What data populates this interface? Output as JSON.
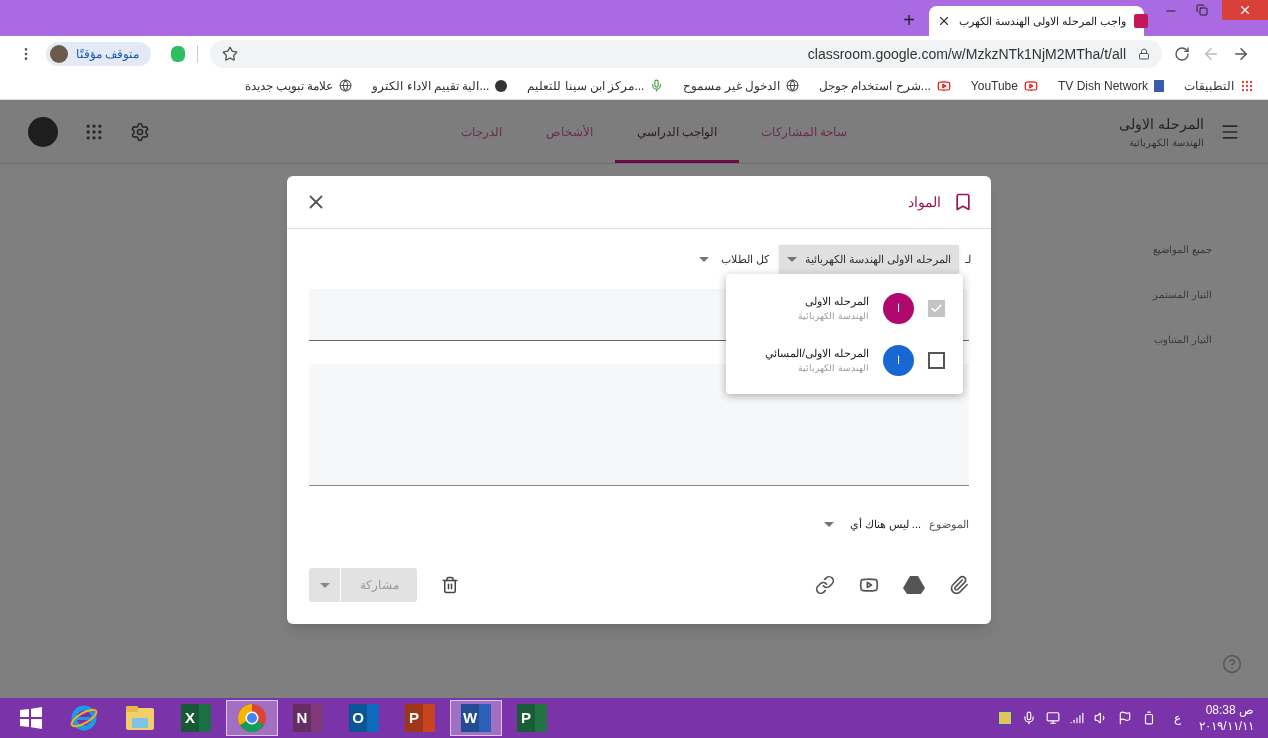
{
  "browser": {
    "tab_title": "واجب المرحله الاولى الهندسة الكهرب",
    "new_tab": "+",
    "url": "classroom.google.com/w/MzkzNTk1NjM2MTha/t/all",
    "profile": "متوقف مؤقتًا"
  },
  "bookmarks": [
    {
      "kind": "apps",
      "label": "التطبيقات"
    },
    {
      "kind": "doc",
      "label": "TV Dish Network"
    },
    {
      "kind": "youtube",
      "label": "YouTube"
    },
    {
      "kind": "youtube",
      "label": "شرح استخدام جوجل..."
    },
    {
      "kind": "globe",
      "label": "الدخول غير مسموح"
    },
    {
      "kind": "mic",
      "label": "مركز ابن سينا للتعليم..."
    },
    {
      "kind": "dark",
      "label": "الية تقييم الاداء الكترو..."
    },
    {
      "kind": "globe",
      "label": "علامة تبويب جديدة"
    }
  ],
  "classroom": {
    "class_name": "المرحله الاولى",
    "class_section": "الهندسة الكهربائية",
    "tabs": [
      {
        "label": "ساحة المشاركات",
        "selected": false
      },
      {
        "label": "الواجب الدراسي",
        "selected": true
      },
      {
        "label": "الأشخاص",
        "selected": false
      },
      {
        "label": "الدرجات",
        "selected": false
      }
    ],
    "topics": [
      "جميع المواضيع",
      "التيار المستمر",
      "التيار المتناوب"
    ]
  },
  "dialog": {
    "title": "المواد",
    "for_label": "لـ",
    "class_chip": "المرحله الاولى الهندسة الكهربائية",
    "students": "كل الطلاب",
    "topic_label": "الموضوع",
    "topic_value": "ليس هناك أي ...",
    "share_button": "مشاركة",
    "share_disabled": true,
    "class_options": [
      {
        "name": "المرحله الاولى",
        "section": "الهندسة الكهربائية",
        "initial": "ا",
        "color": "#b0086f",
        "checked": true
      },
      {
        "name": "المرحله الاولى/المسائي",
        "section": "الهندسة الكهربائية",
        "initial": "ا",
        "color": "#1967d2",
        "checked": false
      }
    ]
  },
  "taskbar": {
    "apps": [
      {
        "kind": "office",
        "letter": "P",
        "color": "#217346",
        "selected": false
      },
      {
        "kind": "office",
        "letter": "W",
        "color": "#2b5fb8",
        "selected": true
      },
      {
        "kind": "office",
        "letter": "P",
        "color": "#c8441f",
        "selected": false
      },
      {
        "kind": "office",
        "letter": "O",
        "color": "#0f6cbd",
        "selected": false
      },
      {
        "kind": "office",
        "letter": "N",
        "color": "#80397b",
        "selected": false
      },
      {
        "kind": "chrome",
        "selected": true
      },
      {
        "kind": "office",
        "letter": "X",
        "color": "#1d7044",
        "selected": false
      },
      {
        "kind": "explorer",
        "selected": false
      },
      {
        "kind": "ie",
        "selected": false
      }
    ],
    "language": "ع",
    "time": "08:38 ص",
    "date": "٢٠١٩/١١/١١"
  }
}
